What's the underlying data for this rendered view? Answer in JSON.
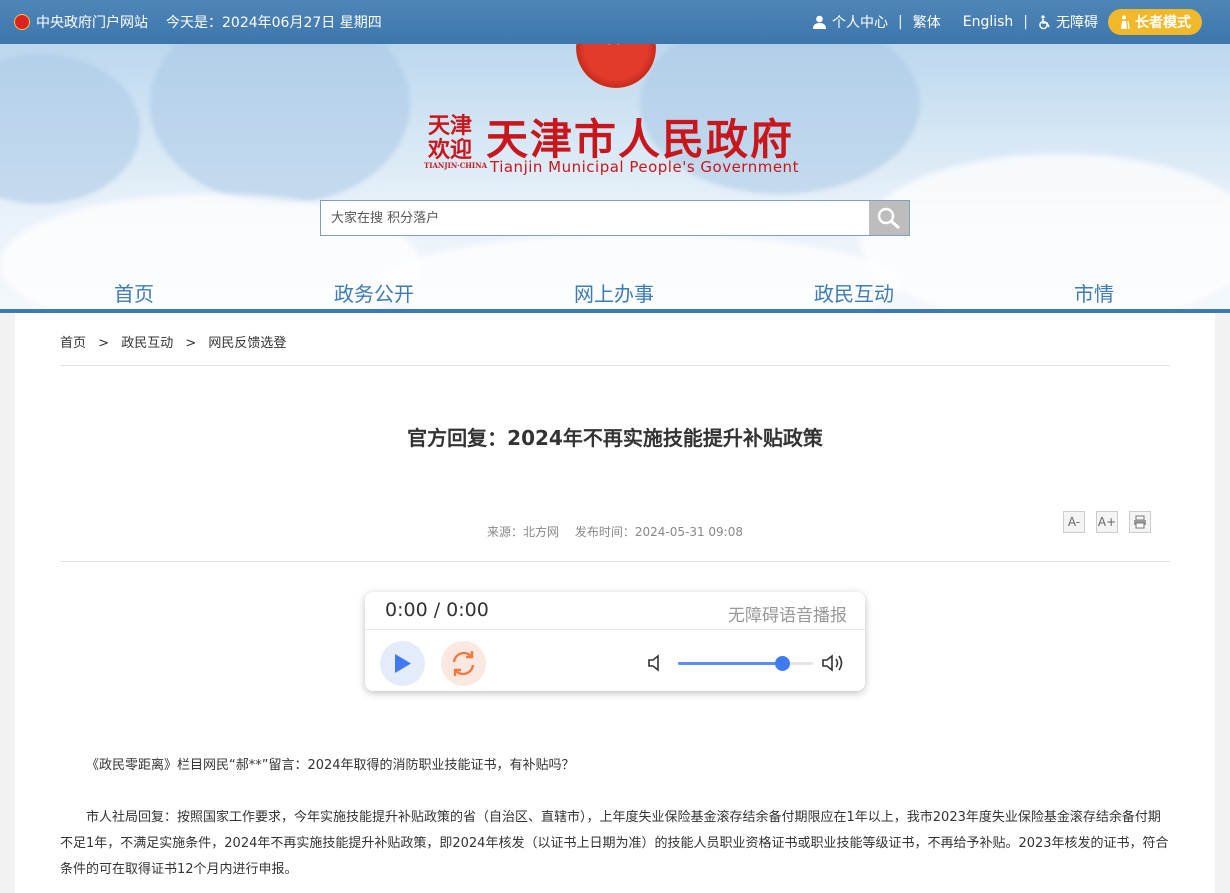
{
  "topbar": {
    "portal": "中央政府门户网站",
    "today": "今天是：2024年06月27日 星期四",
    "personal": "个人中心",
    "sep": "|",
    "traditional": "繁体",
    "english": "English",
    "accessible": "无障碍",
    "elder_mode": "长者模式"
  },
  "header": {
    "seal_line1": "天津",
    "seal_line2": "欢迎",
    "seal_sub": "TIANJIN·CHINA",
    "title_cn": "天津市人民政府",
    "title_en": "Tianjin Municipal People's Government"
  },
  "search": {
    "placeholder": "大家在搜 积分落户"
  },
  "nav": [
    {
      "label": "首页"
    },
    {
      "label": "政务公开"
    },
    {
      "label": "网上办事"
    },
    {
      "label": "政民互动"
    },
    {
      "label": "市情"
    }
  ],
  "breadcrumb": {
    "home": "首页",
    "sep": ">",
    "section": "政民互动",
    "page": "网民反馈选登"
  },
  "article": {
    "title": "官方回复：2024年不再实施技能提升补贴政策",
    "source": "来源：北方网",
    "published": "发布时间：2024-05-31 09:08",
    "font_smaller": "A-",
    "font_larger": "A+",
    "paragraphs": [
      "《政民零距离》栏目网民“郝**”留言：2024年取得的消防职业技能证书，有补贴吗？",
      "市人社局回复：按照国家工作要求，今年实施技能提升补贴政策的省（自治区、直辖市），上年度失业保险基金滚存结余备付期限应在1年以上，我市2023年度失业保险基金滚存结余备付期不足1年，不满足实施条件，2024年不再实施技能提升补贴政策，即2024年核发（以证书上日期为准）的技能人员职业资格证书或职业技能等级证书，不再给予补贴。2023年核发的证书，符合条件的可在取得证书12个月内进行申报。"
    ]
  },
  "player": {
    "time": "0:00 / 0:00",
    "label": "无障碍语音播报",
    "volume": 0.77
  },
  "colors": {
    "accent": "#3d79b2",
    "brand_red": "#c8171c",
    "elder": "#f1b82a"
  }
}
